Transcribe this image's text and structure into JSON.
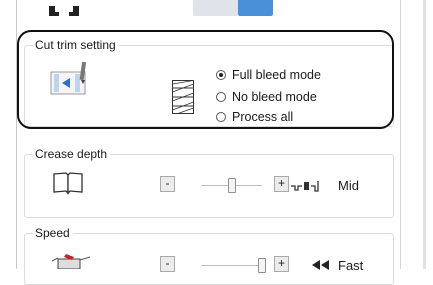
{
  "top": {
    "selected_segment": 2
  },
  "cut_trim": {
    "legend": "Cut trim setting",
    "options": [
      {
        "label": "Full bleed mode",
        "checked": true
      },
      {
        "label": "No bleed mode",
        "checked": false
      },
      {
        "label": "Process all",
        "checked": false
      }
    ]
  },
  "crease": {
    "legend": "Crease depth",
    "minus": "-",
    "plus": "+",
    "level": "Mid",
    "slider_fraction": 0.5
  },
  "speed": {
    "legend": "Speed",
    "minus": "-",
    "plus": "+",
    "level": "Fast",
    "slider_fraction": 1.0
  },
  "colors": {
    "accent": "#4a90d9",
    "icon_blue": "#2f6fd0",
    "highlight_border": "#111111"
  }
}
